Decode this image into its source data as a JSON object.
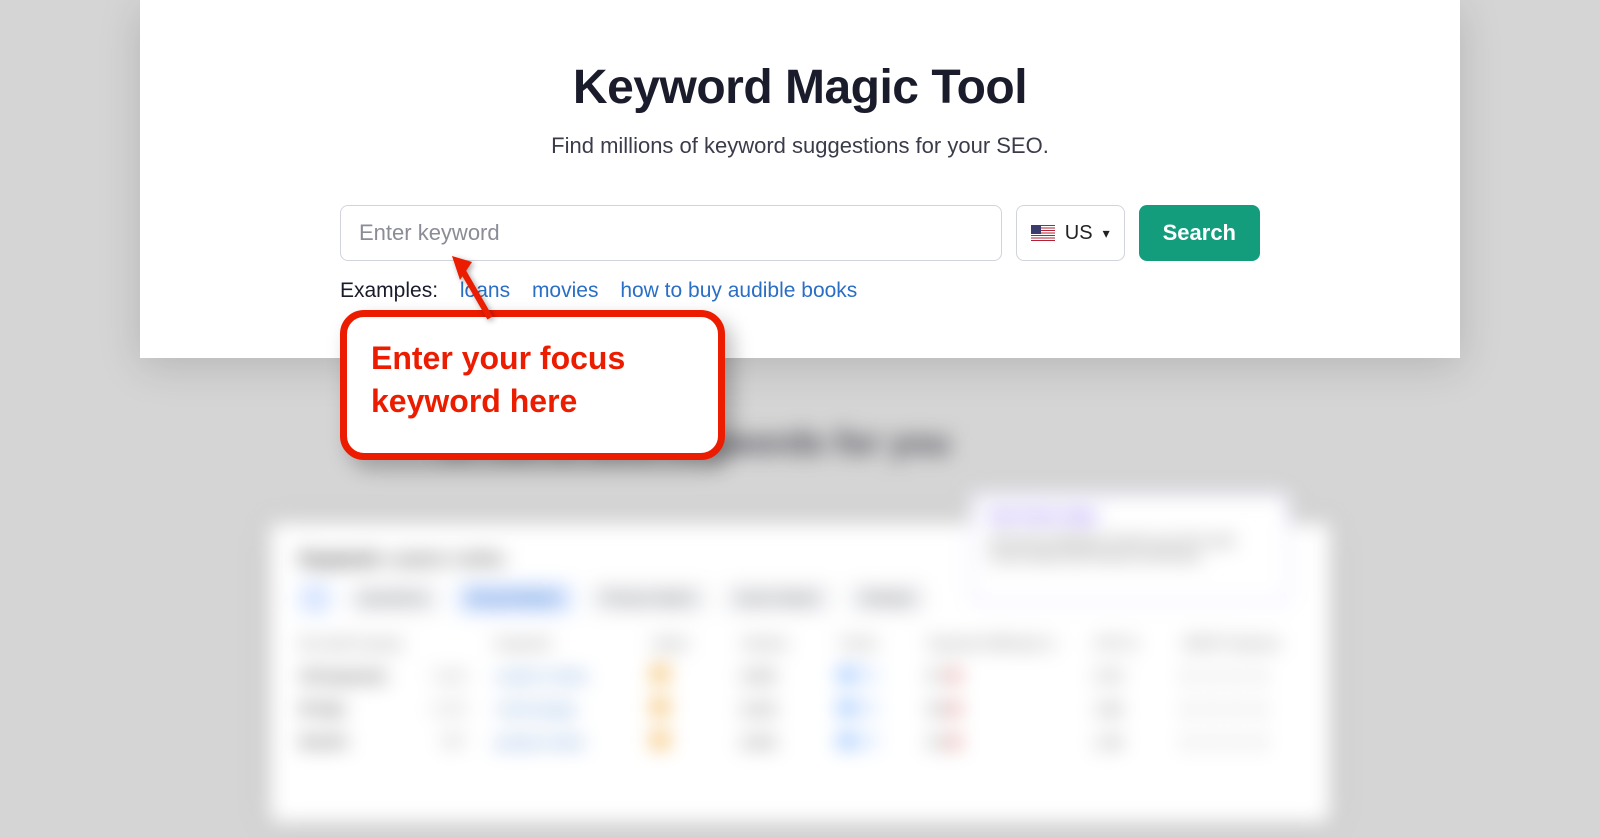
{
  "header": {
    "title": "Keyword Magic Tool",
    "tagline": "Find millions of keyword suggestions for your SEO."
  },
  "search": {
    "placeholder": "Enter keyword",
    "country_code": "US",
    "button_label": "Search"
  },
  "examples": {
    "label": "Examples:",
    "items": [
      "loans",
      "movies",
      "how to buy audible books"
    ]
  },
  "annotation": {
    "text": "Enter your focus keyword here"
  },
  "blur": {
    "heading": "Or list of best keywords for you",
    "sidebox_title": "Get fresh data",
    "sidebox_text": "Semrush database shows you the most recent data and trends at all times.",
    "keyword_label": "Keyword:",
    "keyword_value": "custom t-shirts",
    "tabs": [
      "Questions",
      "Broad Match",
      "Phrase Match",
      "Exact Match",
      "Related"
    ],
    "headers": [
      "By search group",
      "Keyword",
      "Intent",
      "Volume",
      "Trend",
      "Keyword Difficulty %",
      "CPC $",
      "SERP Features"
    ],
    "rows": [
      {
        "group": "All keywords",
        "count": "7,924",
        "kw": "custom t-shirts",
        "intent": "",
        "vol": "9,900",
        "kd": "67",
        "cpc": "2.75",
        "serp": "◻ ◻ ◻ ◻"
      },
      {
        "group": "⊕ logo",
        "count": "1,223",
        "kw": "t-shirt design",
        "intent": "",
        "vol": "8,400",
        "kd": "58",
        "cpc": "1.80",
        "serp": "◻ ◻ ◻ ◻"
      },
      {
        "group": "⊕ print",
        "count": "987",
        "kw": "printed t-shirts",
        "intent": "",
        "vol": "6,600",
        "kd": "54",
        "cpc": "1.45",
        "serp": "◻ ◻ ◻ ◻"
      }
    ]
  }
}
